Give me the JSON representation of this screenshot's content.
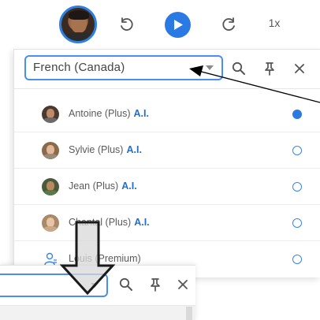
{
  "toolbar": {
    "speed_label": "1x",
    "accent_color": "#2b79e3",
    "icons": [
      "avatar",
      "rewind-icon",
      "play-icon",
      "forward-icon"
    ]
  },
  "voice_panel": {
    "language_selected": "French (Canada)",
    "icons": [
      "search-icon",
      "pin-icon",
      "close-icon"
    ],
    "voices": [
      {
        "name": "Antoine (Plus)",
        "badge": "A.I.",
        "selected": true
      },
      {
        "name": "Sylvie (Plus)",
        "badge": "A.I.",
        "selected": false
      },
      {
        "name": "Jean (Plus)",
        "badge": "A.I.",
        "selected": false
      },
      {
        "name": "Chantal (Plus)",
        "badge": "A.I.",
        "selected": false
      },
      {
        "name": "Louis (Premium)",
        "badge": "",
        "selected": false
      }
    ]
  },
  "lower_panel": {
    "icons": [
      "search-icon",
      "pin-icon",
      "close-icon"
    ]
  }
}
